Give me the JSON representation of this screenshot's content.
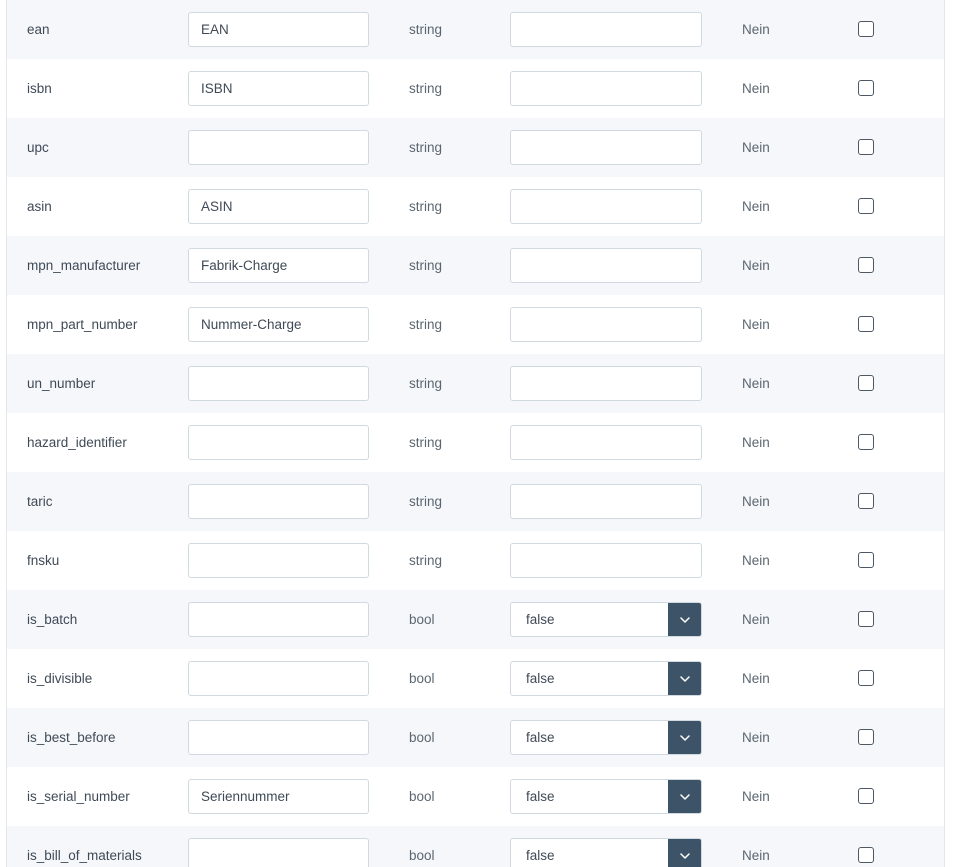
{
  "rows": [
    {
      "name": "ean",
      "label": "EAN",
      "type": "string",
      "default": "",
      "default_kind": "input",
      "required": "Nein",
      "checked": false
    },
    {
      "name": "isbn",
      "label": "ISBN",
      "type": "string",
      "default": "",
      "default_kind": "input",
      "required": "Nein",
      "checked": false
    },
    {
      "name": "upc",
      "label": "",
      "type": "string",
      "default": "",
      "default_kind": "input",
      "required": "Nein",
      "checked": false
    },
    {
      "name": "asin",
      "label": "ASIN",
      "type": "string",
      "default": "",
      "default_kind": "input",
      "required": "Nein",
      "checked": false
    },
    {
      "name": "mpn_manufacturer",
      "label": "Fabrik-Charge",
      "type": "string",
      "default": "",
      "default_kind": "input",
      "required": "Nein",
      "checked": false
    },
    {
      "name": "mpn_part_number",
      "label": "Nummer-Charge",
      "type": "string",
      "default": "",
      "default_kind": "input",
      "required": "Nein",
      "checked": false
    },
    {
      "name": "un_number",
      "label": "",
      "type": "string",
      "default": "",
      "default_kind": "input",
      "required": "Nein",
      "checked": false
    },
    {
      "name": "hazard_identifier",
      "label": "",
      "type": "string",
      "default": "",
      "default_kind": "input",
      "required": "Nein",
      "checked": false
    },
    {
      "name": "taric",
      "label": "",
      "type": "string",
      "default": "",
      "default_kind": "input",
      "required": "Nein",
      "checked": false
    },
    {
      "name": "fnsku",
      "label": "",
      "type": "string",
      "default": "",
      "default_kind": "input",
      "required": "Nein",
      "checked": false
    },
    {
      "name": "is_batch",
      "label": "",
      "type": "bool",
      "default": "false",
      "default_kind": "select",
      "required": "Nein",
      "checked": false
    },
    {
      "name": "is_divisible",
      "label": "",
      "type": "bool",
      "default": "false",
      "default_kind": "select",
      "required": "Nein",
      "checked": false
    },
    {
      "name": "is_best_before",
      "label": "",
      "type": "bool",
      "default": "false",
      "default_kind": "select",
      "required": "Nein",
      "checked": false
    },
    {
      "name": "is_serial_number",
      "label": "Seriennummer",
      "type": "bool",
      "default": "false",
      "default_kind": "select",
      "required": "Nein",
      "checked": false
    },
    {
      "name": "is_bill_of_materials",
      "label": "",
      "type": "bool",
      "default": "false",
      "default_kind": "select",
      "required": "Nein",
      "checked": false
    }
  ],
  "icons": {
    "select_toggle": "chevron-down-icon"
  },
  "colors": {
    "row_alt": "#f5f7fa",
    "select_button": "#3d5468"
  }
}
